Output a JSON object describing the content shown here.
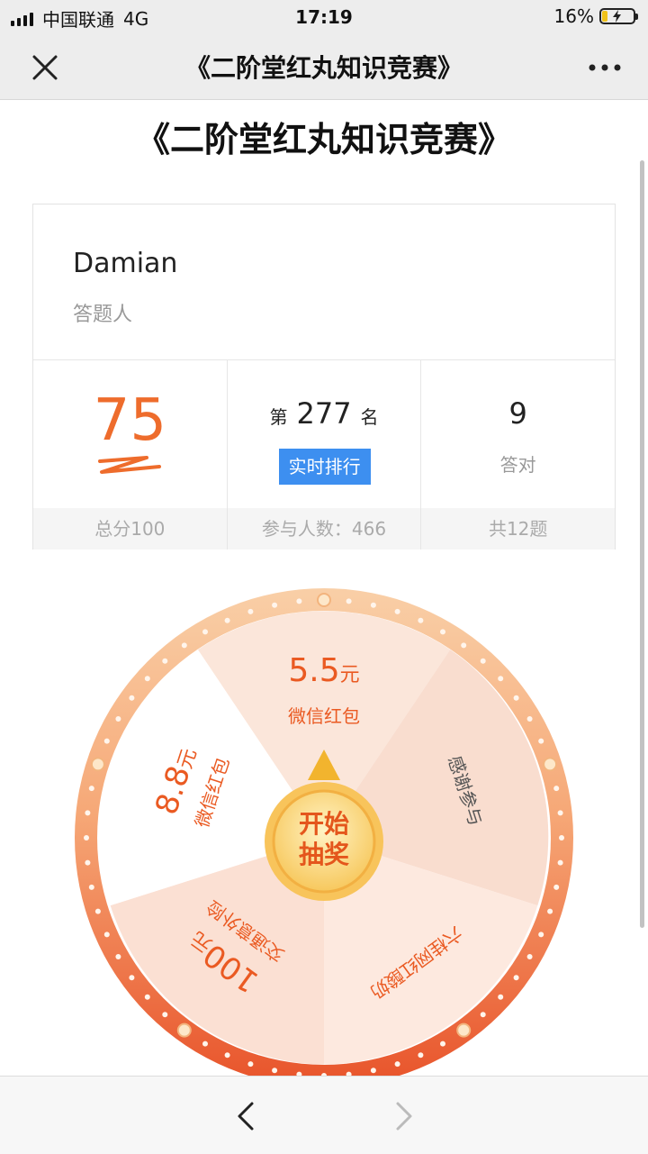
{
  "status_bar": {
    "carrier": "中国联通",
    "network": "4G",
    "time": "17:19",
    "battery": "16%"
  },
  "nav": {
    "title": "《二阶堂红丸知识竞赛》"
  },
  "page": {
    "title": "《二阶堂红丸知识竞赛》"
  },
  "player": {
    "name": "Damian",
    "role": "答题人"
  },
  "stats": {
    "score": "75",
    "score_total": "总分100",
    "rank_prefix": "第",
    "rank": "277",
    "rank_suffix": "名",
    "rank_button": "实时排行",
    "participants": "参与人数：466",
    "correct": "9",
    "correct_label": "答对",
    "total_questions": "共12题"
  },
  "wheel": {
    "segments": [
      {
        "amount": "5.5",
        "unit": "元",
        "label": "微信红包"
      },
      {
        "label": "感谢参与"
      },
      {
        "label": "六桂网红酸奶"
      },
      {
        "amount": "100",
        "unit": "元",
        "label": "交通意外险"
      },
      {
        "amount": "8.8",
        "unit": "元",
        "label": "微信红包"
      }
    ],
    "button_line1": "开始",
    "button_line2": "抽奖"
  },
  "colors": {
    "accent": "#ee6c2c",
    "blue": "#3d8ff0"
  }
}
